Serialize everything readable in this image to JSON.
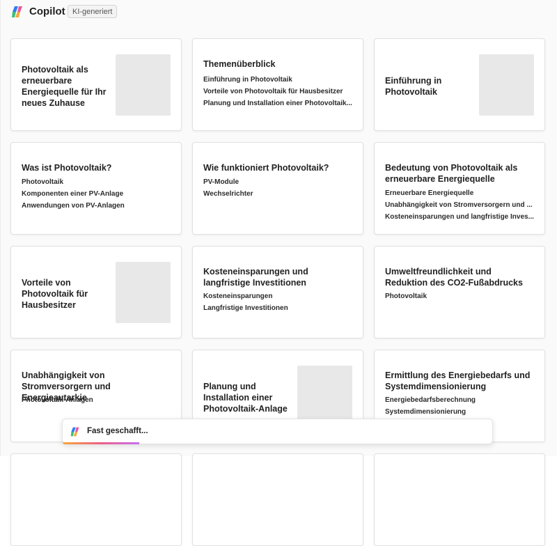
{
  "header": {
    "app_name": "Copilot",
    "badge": "KI-generiert"
  },
  "cards": [
    {
      "title": "Photovoltaik als erneuerbare Energiequelle für Ihr neues Zuhause",
      "items": []
    },
    {
      "title": "Themenüberblick",
      "items": [
        "Einführung in Photovoltaik",
        "Vorteile von Photovoltaik für Hausbesitzer",
        "Planung und Installation einer Photovoltaik..."
      ]
    },
    {
      "title": "Einführung in Photovoltaik",
      "items": []
    },
    {
      "title": "Was ist Photovoltaik?",
      "items": [
        "Photovoltaik",
        "Komponenten einer PV-Anlage",
        "Anwendungen von PV-Anlagen"
      ]
    },
    {
      "title": "Wie funktioniert Photovoltaik?",
      "items": [
        "PV-Module",
        "Wechselrichter"
      ]
    },
    {
      "title": "Bedeutung von Photovoltaik als erneuerbare Energiequelle",
      "items": [
        "Erneuerbare Energiequelle",
        "Unabhängigkeit von Stromversorgern und ...",
        "Kosteneinsparungen und langfristige Inves..."
      ]
    },
    {
      "title": "Vorteile von Photovoltaik für Hausbesitzer",
      "items": []
    },
    {
      "title": "Kosteneinsparungen und langfristige Investitionen",
      "items": [
        "Kosteneinsparungen",
        "Langfristige Investitionen"
      ]
    },
    {
      "title": "Umweltfreundlichkeit und Reduktion des CO2-Fußabdrucks",
      "items": [
        "Photovoltaik"
      ]
    },
    {
      "title": "Unabhängigkeit von Stromversorgern und Energieautarkie",
      "items": [
        "Photovoltaik-Anlagen"
      ]
    },
    {
      "title": "Planung und Installation einer Photovoltaik-Anlage",
      "items": []
    },
    {
      "title": "Ermittlung des Energiebedarfs und Systemdimensionierung",
      "items": [
        "Energiebedarfsberechnung",
        "Systemdimensionierung"
      ]
    }
  ],
  "toast": {
    "message": "Fast geschafft..."
  },
  "colors": {
    "logo_blue": "#2f7ef5",
    "logo_green": "#3cc07a",
    "logo_orange": "#f7a73b",
    "logo_pink": "#e8589e"
  }
}
